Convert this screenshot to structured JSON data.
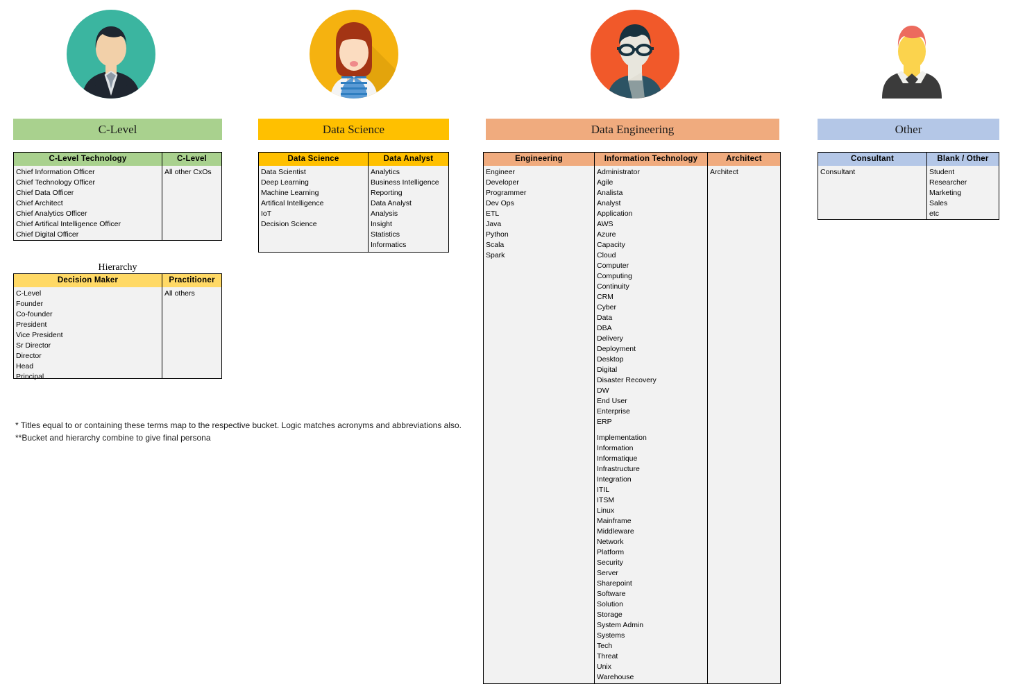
{
  "avatars": [
    {
      "name": "c-level-avatar",
      "bg": "#3bb5a0",
      "alt": "man in dark suit with tie"
    },
    {
      "name": "data-science-avatar",
      "bg": "#f5b210",
      "alt": "woman with auburn hair in blue striped top"
    },
    {
      "name": "data-engineering-avatar",
      "bg": "#f1592a",
      "alt": "man with glasses in teal shirt"
    },
    {
      "name": "other-avatar",
      "bg": "#ffffff",
      "alt": "man with red hair in dark suit"
    }
  ],
  "banners": {
    "c_level": "C-Level",
    "data_science": "Data Science",
    "data_engineering": "Data Engineering",
    "other": "Other"
  },
  "colors": {
    "green": "#a9d18e",
    "amber": "#ffc000",
    "light_amber": "#ffd966",
    "salmon": "#f0ab7e",
    "blue": "#b4c7e7",
    "cell_bg": "#f2f2f2"
  },
  "tables": {
    "c_level": {
      "columns": [
        {
          "header": "C-Level Technology",
          "items": [
            "Chief Information Officer",
            "Chief Technology Officer",
            "Chief Data Officer",
            "Chief Architect",
            "Chief Analytics Officer",
            "Chief Artifical Intelligence Officer",
            "Chief Digital Officer"
          ]
        },
        {
          "header": "C-Level",
          "items": [
            "All other CxOs"
          ]
        }
      ]
    },
    "hierarchy": {
      "caption": "Hierarchy",
      "columns": [
        {
          "header": "Decision Maker",
          "items": [
            "C-Level",
            "Founder",
            "Co-founder",
            "President",
            "Vice President",
            "Sr Director",
            "Director",
            "Head",
            "Principal"
          ]
        },
        {
          "header": "Practitioner",
          "items": [
            "All others"
          ]
        }
      ]
    },
    "data_science": {
      "columns": [
        {
          "header": "Data Science",
          "items": [
            "Data Scientist",
            "Deep Learning",
            "Machine Learning",
            "Artifical Intelligence",
            "IoT",
            "Decision Science"
          ]
        },
        {
          "header": "Data Analyst",
          "items": [
            "Analytics",
            "Business Intelligence",
            "Reporting",
            "Data Analyst",
            "Analysis",
            "Insight",
            "Statistics",
            "Informatics"
          ]
        }
      ]
    },
    "data_engineering": {
      "columns": [
        {
          "header": "Engineering",
          "items": [
            "Engineer",
            "Developer",
            "Programmer",
            "Dev Ops",
            "ETL",
            "Java",
            "Python",
            "Scala",
            "Spark"
          ]
        },
        {
          "header": "Information Technology",
          "items": [
            "Administrator",
            "Agile",
            "Analista",
            "Analyst",
            "Application",
            "AWS",
            "Azure",
            "Capacity",
            "Cloud",
            "Computer",
            "Computing",
            "Continuity",
            "CRM",
            "Cyber",
            "Data",
            "DBA",
            "Delivery",
            "Deployment",
            "Desktop",
            "Digital",
            "Disaster Recovery",
            "DW",
            "End User",
            "Enterprise",
            "ERP",
            "",
            "Implementation",
            "Information",
            "Informatique",
            "Infrastructure",
            "Integration",
            "ITIL",
            "ITSM",
            "Linux",
            "Mainframe",
            "Middleware",
            "Network",
            "Platform",
            "Security",
            "Server",
            "Sharepoint",
            "Software",
            "Solution",
            "Storage",
            "System Admin",
            "Systems",
            "Tech",
            "Threat",
            "Unix",
            "Warehouse"
          ]
        },
        {
          "header": "Architect",
          "items": [
            "Architect"
          ]
        }
      ]
    },
    "other": {
      "columns": [
        {
          "header": "Consultant",
          "items": [
            "Consultant"
          ]
        },
        {
          "header": "Blank / Other",
          "items": [
            "Student",
            "Researcher",
            "Marketing",
            "Sales",
            "etc"
          ]
        }
      ]
    }
  },
  "footnotes": {
    "line1": "* Titles equal to or containing these terms map to the respective bucket. Logic matches acronyms and abbreviations also.",
    "line2": "**Bucket and hierarchy combine to give final persona"
  }
}
